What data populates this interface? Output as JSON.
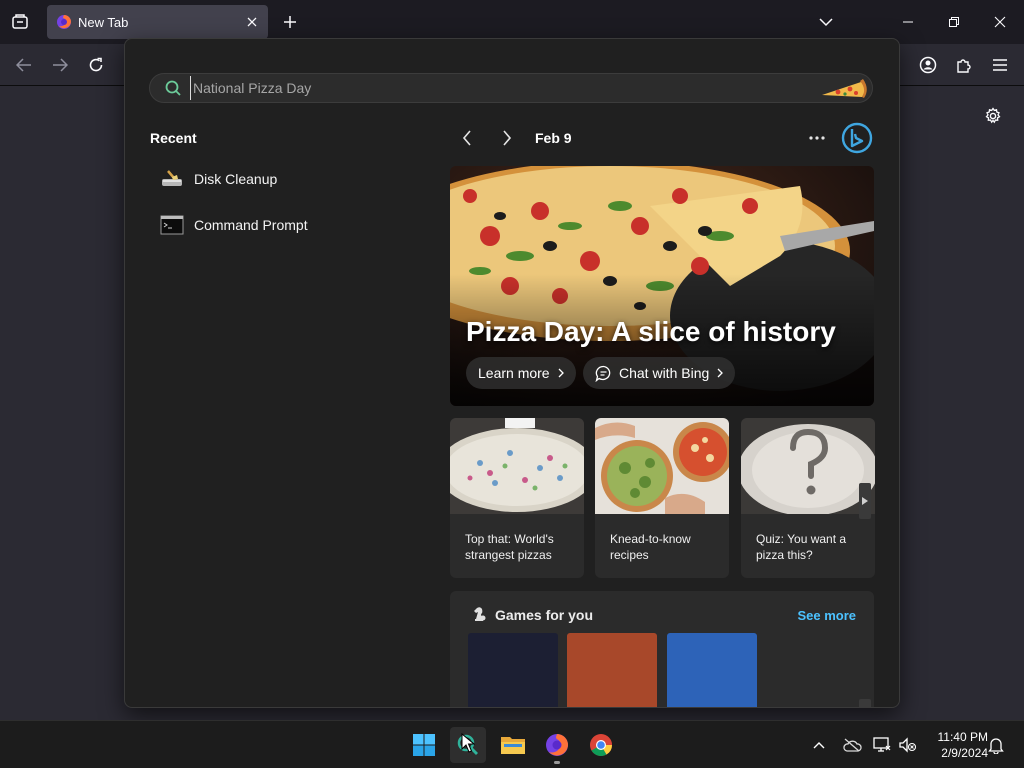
{
  "browser": {
    "tab_title": "New Tab"
  },
  "search": {
    "placeholder": "National Pizza Day"
  },
  "recent": {
    "title": "Recent",
    "items": [
      {
        "label": "Disk Cleanup",
        "icon": "disk-cleanup-icon"
      },
      {
        "label": "Command Prompt",
        "icon": "command-prompt-icon"
      }
    ]
  },
  "highlights": {
    "date": "Feb 9",
    "hero_title": "Pizza Day: A slice of history",
    "learn_more": "Learn more",
    "chat_bing": "Chat with Bing",
    "cards": [
      {
        "label": "Top that: World's strangest pizzas"
      },
      {
        "label": "Knead-to-know recipes"
      },
      {
        "label": "Quiz: You want a pizza this?"
      }
    ]
  },
  "games": {
    "title": "Games for you",
    "see_more": "See more",
    "tile_colors": [
      "#1c1f33",
      "#a8482a",
      "#2d63b8"
    ]
  },
  "taskbar": {
    "time": "11:40 PM",
    "date": "2/9/2024"
  },
  "colors": {
    "accent": "#4cc2ff",
    "flyout_bg": "#202020",
    "browser_bg": "#2b2a33"
  }
}
